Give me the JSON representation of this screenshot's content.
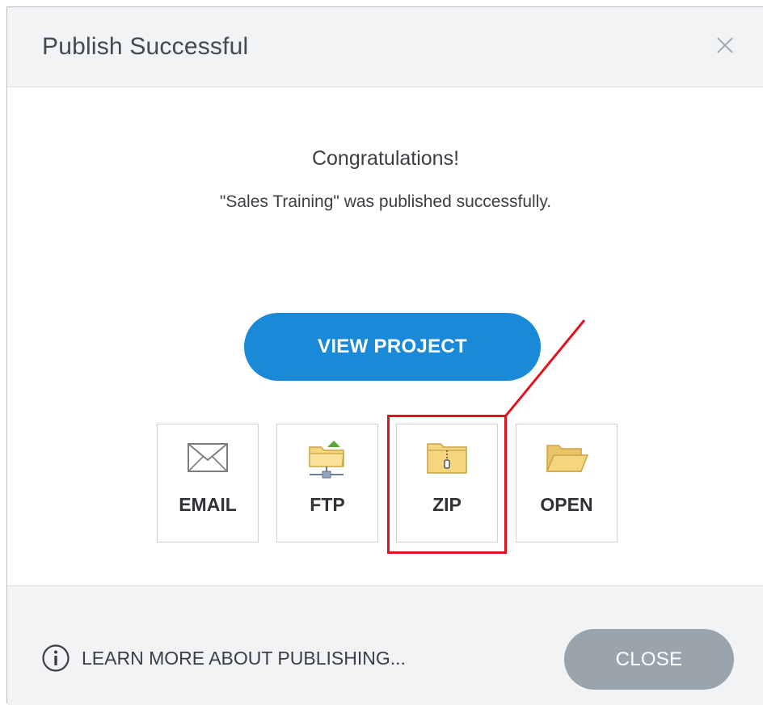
{
  "dialog": {
    "title": "Publish Successful",
    "close_icon": "close-x-icon"
  },
  "body": {
    "heading": "Congratulations!",
    "message": "\"Sales Training\" was published successfully.",
    "view_project_label": "VIEW PROJECT"
  },
  "actions": [
    {
      "label": "EMAIL",
      "icon": "envelope-icon"
    },
    {
      "label": "FTP",
      "icon": "ftp-folder-icon"
    },
    {
      "label": "ZIP",
      "icon": "zip-folder-icon"
    },
    {
      "label": "OPEN",
      "icon": "open-folder-icon"
    }
  ],
  "annotation": {
    "highlighted_action": "ZIP",
    "color": "#e0141f"
  },
  "footer": {
    "learn_more_label": "LEARN MORE ABOUT PUBLISHING...",
    "close_label": "CLOSE"
  },
  "colors": {
    "primary": "#1a8ad8",
    "disabled_button": "#9aa4ad",
    "header_bg": "#f1f3f5",
    "folder": "#f6d57f"
  }
}
